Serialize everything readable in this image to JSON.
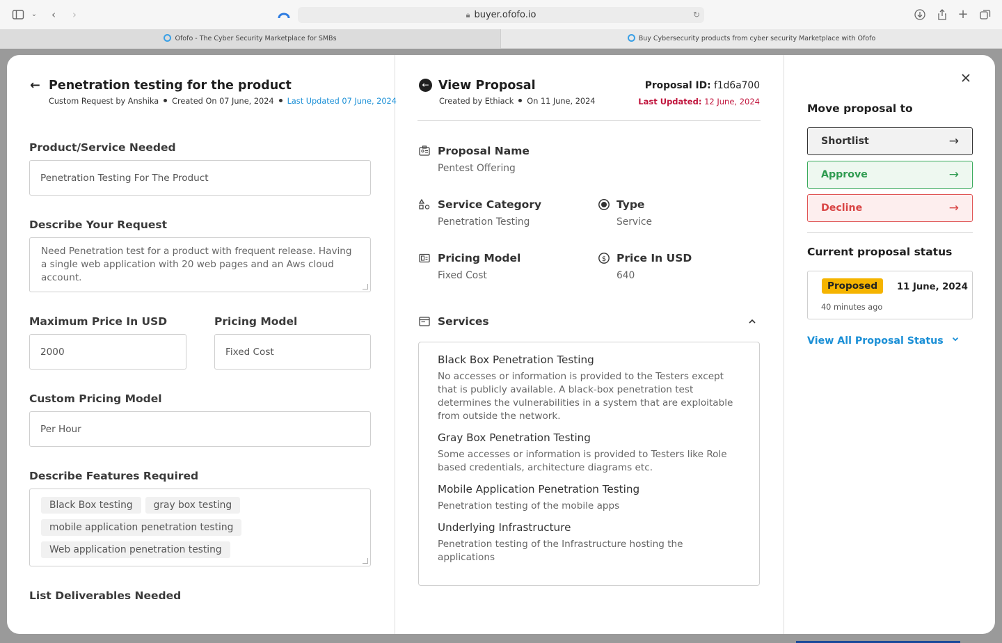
{
  "browser": {
    "url": "buyer.ofofo.io",
    "tabs": [
      {
        "title": "Ofofo - The Cyber Security Marketplace for SMBs"
      },
      {
        "title": "Buy Cybersecurity products from cyber security Marketplace with Ofofo"
      }
    ]
  },
  "request": {
    "title": "Penetration testing for the product",
    "custom_by": "Custom Request by Anshika",
    "created_on": "Created On 07 June, 2024",
    "last_updated": "Last Updated 07 June, 2024",
    "product_label": "Product/Service Needed",
    "product_value": "Penetration Testing For The Product",
    "describe_label": "Describe Your Request",
    "describe_value": "Need Penetration test for a product with frequent release. Having a single web application with 20 web pages and an Aws cloud account.",
    "max_price_label": "Maximum Price In USD",
    "max_price_value": "2000",
    "pricing_model_label": "Pricing Model",
    "pricing_model_value": "Fixed Cost",
    "custom_pricing_label": "Custom Pricing Model",
    "custom_pricing_value": "Per Hour",
    "features_label": "Describe Features Required",
    "features": [
      "Black Box testing",
      "gray box testing",
      "mobile application penetration testing",
      "Web application penetration testing"
    ],
    "deliverables_label": "List Deliverables Needed"
  },
  "proposal": {
    "title": "View Proposal",
    "created_by": "Created by Ethiack",
    "on_date": "On 11 June, 2024",
    "id_label": "Proposal ID:",
    "id_value": "f1d6a700",
    "updated_label": "Last Updated:",
    "updated_value": "12 June, 2024",
    "name_label": "Proposal Name",
    "name_value": "Pentest Offering",
    "category_label": "Service Category",
    "category_value": "Penetration Testing",
    "type_label": "Type",
    "type_value": "Service",
    "pricing_label": "Pricing Model",
    "pricing_value": "Fixed Cost",
    "price_label": "Price In USD",
    "price_value": "640",
    "services_label": "Services",
    "services": [
      {
        "name": "Black Box Penetration Testing",
        "desc": "No accesses or information is provided to the Testers except that is publicly available. A black-box penetration test determines the vulnerabilities in a system that are exploitable from outside the network."
      },
      {
        "name": "Gray Box Penetration Testing",
        "desc": "Some accesses or information is provided to Testers like Role based credentials, architecture diagrams etc."
      },
      {
        "name": "Mobile Application Penetration Testing",
        "desc": "Penetration testing of the mobile apps"
      },
      {
        "name": "Underlying Infrastructure",
        "desc": "Penetration testing of the Infrastructure hosting the applications"
      }
    ]
  },
  "sidebar": {
    "move_label": "Move proposal to",
    "shortlist": "Shortlist",
    "approve": "Approve",
    "decline": "Decline",
    "status_label": "Current proposal status",
    "badge": "Proposed",
    "status_date": "11 June, 2024",
    "status_ago": "40 minutes ago",
    "view_all": "View All Proposal Status"
  },
  "colors": {
    "accent_blue": "#1a8fd6",
    "badge_yellow": "#f5b400",
    "approve_green": "#2f9b50",
    "decline_red": "#d94545",
    "updated_red": "#c0143c"
  }
}
